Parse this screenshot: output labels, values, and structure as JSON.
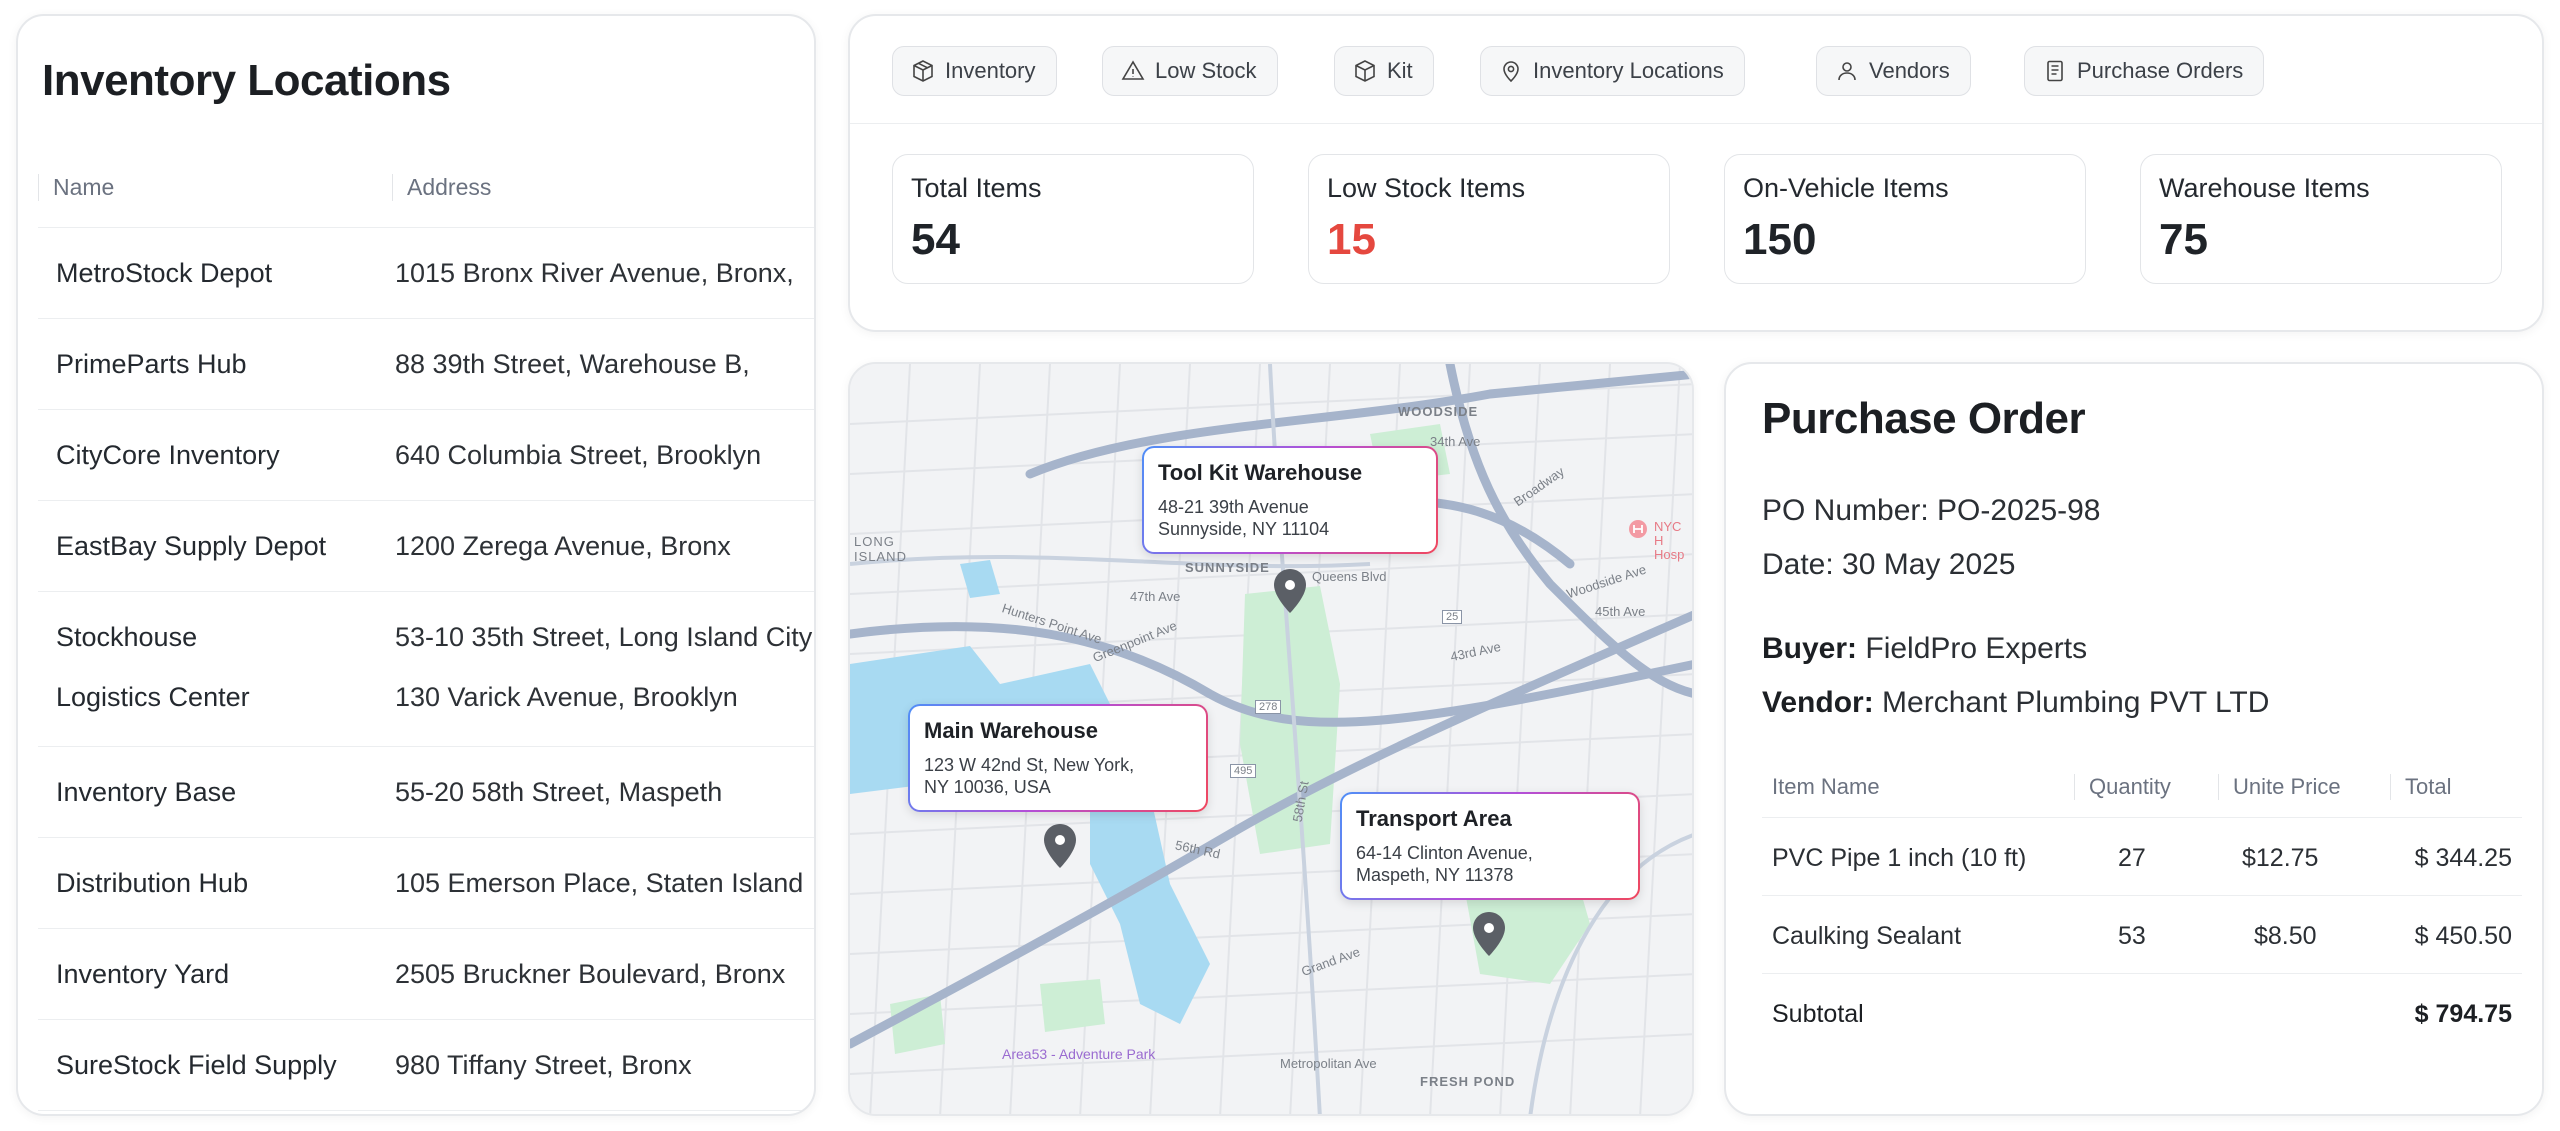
{
  "locations": {
    "title": "Inventory Locations",
    "columns": [
      "Name",
      "Address"
    ],
    "rows": [
      {
        "name": "MetroStock Depot",
        "address": "1015 Bronx River Avenue, Bronx,"
      },
      {
        "name": "PrimeParts Hub",
        "address": "88 39th Street, Warehouse B,"
      },
      {
        "name": "CityCore Inventory",
        "address": "640 Columbia Street, Brooklyn"
      },
      {
        "name": "EastBay Supply Depot",
        "address": "1200 Zerega Avenue, Bronx"
      },
      {
        "name": "Stockhouse",
        "address": "53-10 35th Street, Long Island City"
      },
      {
        "name": "Logistics Center",
        "address": "130 Varick Avenue, Brooklyn"
      },
      {
        "name": "Inventory Base",
        "address": "55-20 58th Street, Maspeth"
      },
      {
        "name": "Distribution Hub",
        "address": "105 Emerson Place, Staten Island"
      },
      {
        "name": "Inventory Yard",
        "address": "2505 Bruckner Boulevard, Bronx"
      },
      {
        "name": "SureStock Field Supply",
        "address": "980 Tiffany Street, Bronx"
      }
    ]
  },
  "tabs": [
    {
      "label": "Inventory",
      "icon": "box-icon"
    },
    {
      "label": "Low Stock",
      "icon": "warning-triangle-icon"
    },
    {
      "label": "Kit",
      "icon": "cube-icon"
    },
    {
      "label": "Inventory Locations",
      "icon": "map-pin-icon"
    },
    {
      "label": "Vendors",
      "icon": "user-icon"
    },
    {
      "label": "Purchase Orders",
      "icon": "document-icon"
    }
  ],
  "stats": [
    {
      "label": "Total Items",
      "value": "54"
    },
    {
      "label": "Low Stock Items",
      "value": "15",
      "accent": "#e5483f"
    },
    {
      "label": "On-Vehicle Items",
      "value": "150"
    },
    {
      "label": "Warehouse Items",
      "value": "75"
    }
  ],
  "map": {
    "markers": [
      {
        "title": "Tool Kit Warehouse",
        "address": "48-21 39th Avenue\n Sunnyside, NY 11104"
      },
      {
        "title": "Main Warehouse",
        "address": "123 W 42nd St, New York,\nNY 10036, USA"
      },
      {
        "title": "Transport Area",
        "address": "64-14 Clinton Avenue,\nMaspeth, NY 11378"
      }
    ],
    "labels": {
      "woodside": "WOODSIDE",
      "sunnyside": "SUNNYSIDE",
      "fresh_pond": "FRESH POND",
      "long_island": "LONG\nISLAND",
      "area53": "Area53 - Adventure Park",
      "hospital": "NYC H\nHosp",
      "greenpoint": "Greenpoint Ave",
      "hunters": "Hunters Point Ave",
      "grand": "Grand Ave",
      "metropolitan": "Metropolitan Ave",
      "r56": "56th Rd",
      "st58": "58th St",
      "st47": "47th Ave",
      "st43": "43rd Ave",
      "broadway": "Broadway",
      "woodside_ave": "Woodside Ave",
      "ave45": "45th Ave",
      "st34": "34th Ave",
      "queens": "Queens Blvd",
      "hwy278": "278",
      "hwy495": "495",
      "hwy25": "25"
    },
    "colors": {
      "water": "#a8daf2",
      "park": "#cdeed5",
      "highway": "#a6b4cb",
      "pin": "#5b5f66"
    }
  },
  "purchase_order": {
    "title": "Purchase Order",
    "po_number": "PO Number: PO-2025-98",
    "date": "Date: 30 May 2025",
    "buyer_label": "Buyer:",
    "buyer": "FieldPro Experts",
    "vendor_label": "Vendor:",
    "vendor": "Merchant Plumbing PVT LTD",
    "columns": [
      "Item Name",
      "Quantity",
      "Unite Price",
      "Total"
    ],
    "items": [
      {
        "name": "PVC Pipe 1 inch (10 ft)",
        "qty": "27",
        "price": "$12.75",
        "total": "$ 344.25"
      },
      {
        "name": "Caulking Sealant",
        "qty": "53",
        "price": "$8.50",
        "total": "$ 450.50"
      }
    ],
    "subtotal_label": "Subtotal",
    "subtotal": "$ 794.75"
  }
}
